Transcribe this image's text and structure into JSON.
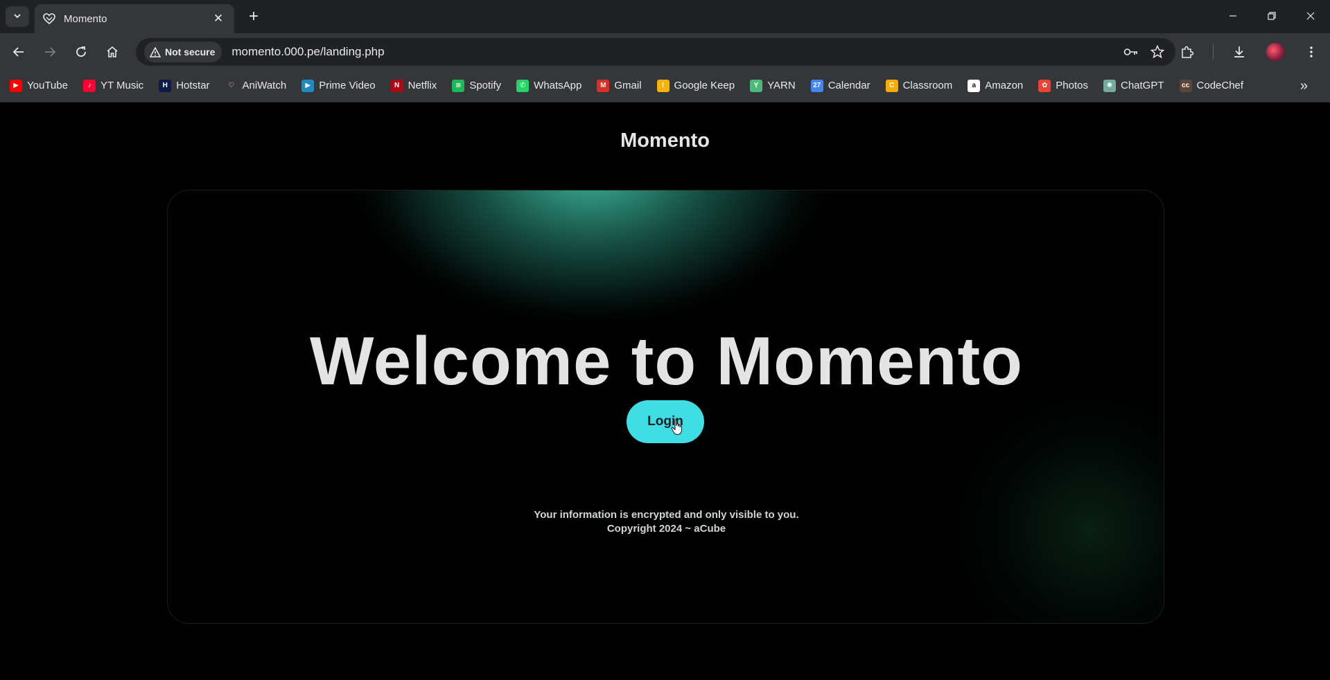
{
  "browser": {
    "tab": {
      "title": "Momento",
      "favicon": "momento-heart-icon"
    },
    "new_tab_label": "+",
    "address_bar": {
      "security_label": "Not secure",
      "url": "momento.000.pe/landing.php"
    },
    "bookmarks": [
      {
        "label": "YouTube",
        "icon": "youtube-icon",
        "color": "#ff0000",
        "glyph": "▶"
      },
      {
        "label": "YT Music",
        "icon": "yt-music-icon",
        "color": "#ff0033",
        "glyph": "♪"
      },
      {
        "label": "Hotstar",
        "icon": "hotstar-icon",
        "color": "#0c1a4a",
        "glyph": "H"
      },
      {
        "label": "AniWatch",
        "icon": "aniwatch-icon",
        "color": "#35363a",
        "glyph": "♡"
      },
      {
        "label": "Prime Video",
        "icon": "prime-video-icon",
        "color": "#1f8ac0",
        "glyph": "▶"
      },
      {
        "label": "Netflix",
        "icon": "netflix-icon",
        "color": "#b20710",
        "glyph": "N"
      },
      {
        "label": "Spotify",
        "icon": "spotify-icon",
        "color": "#1db954",
        "glyph": "≋"
      },
      {
        "label": "WhatsApp",
        "icon": "whatsapp-icon",
        "color": "#25d366",
        "glyph": "✆"
      },
      {
        "label": "Gmail",
        "icon": "gmail-icon",
        "color": "#d93025",
        "glyph": "M"
      },
      {
        "label": "Google Keep",
        "icon": "google-keep-icon",
        "color": "#f4b400",
        "glyph": "!"
      },
      {
        "label": "YARN",
        "icon": "yarn-icon",
        "color": "#4cb87a",
        "glyph": "Y"
      },
      {
        "label": "Calendar",
        "icon": "calendar-icon",
        "color": "#4285f4",
        "glyph": "27"
      },
      {
        "label": "Classroom",
        "icon": "classroom-icon",
        "color": "#f9ab00",
        "glyph": "C"
      },
      {
        "label": "Amazon",
        "icon": "amazon-icon",
        "color": "#ffffff",
        "glyph": "a"
      },
      {
        "label": "Photos",
        "icon": "photos-icon",
        "color": "#ea4335",
        "glyph": "✿"
      },
      {
        "label": "ChatGPT",
        "icon": "chatgpt-icon",
        "color": "#74aa9c",
        "glyph": "✺"
      },
      {
        "label": "CodeChef",
        "icon": "codechef-icon",
        "color": "#5b4638",
        "glyph": "cc"
      }
    ]
  },
  "page": {
    "site_title": "Momento",
    "heading": "Welcome to Momento",
    "login_label": "Login",
    "footer_note": "Your information is encrypted and only visible to you.",
    "footer_copy": "Copyright 2024 ~ aCube",
    "accent_color": "#3fdde4"
  }
}
